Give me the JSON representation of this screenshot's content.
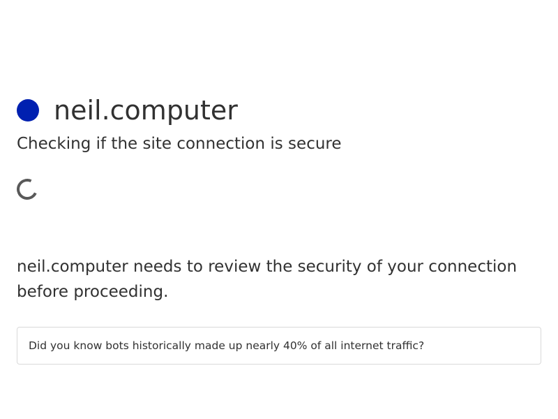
{
  "site": {
    "name": "neil.computer",
    "icon": "site-favicon-dot",
    "icon_color": "#0020b0"
  },
  "status": {
    "heading": "Checking if the site connection is secure",
    "spinner_icon": "loading-spinner-icon",
    "spinner_color": "#595959"
  },
  "message": "neil.computer needs to review the security of your connection before proceeding.",
  "info_box": {
    "text": "Did you know bots historically made up nearly 40% of all internet traffic?"
  }
}
